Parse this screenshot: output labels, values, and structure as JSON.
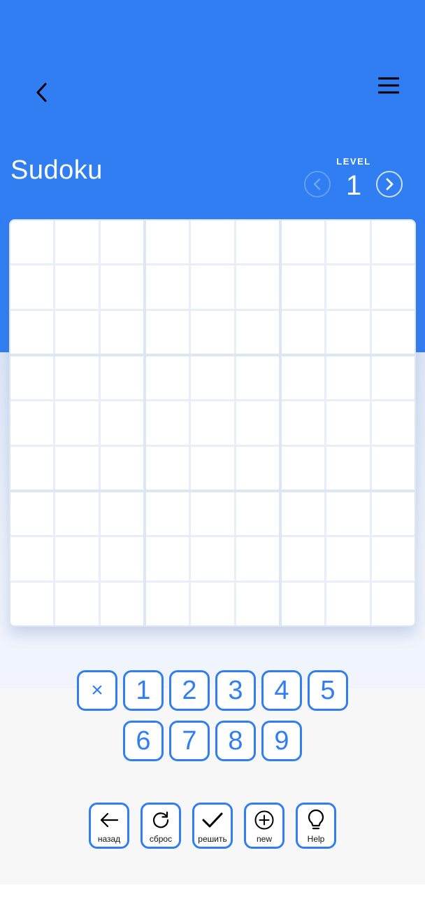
{
  "header": {
    "title": "Sudoku",
    "back_icon": "chevron-left-icon",
    "menu_icon": "hamburger-menu-icon"
  },
  "level": {
    "label": "LEVEL",
    "value": "1",
    "prev_icon": "chevron-left-icon",
    "next_icon": "chevron-right-icon"
  },
  "board": {
    "cells": [
      [
        "",
        "",
        "",
        "",
        "",
        "",
        "",
        "",
        ""
      ],
      [
        "",
        "",
        "",
        "",
        "",
        "",
        "",
        "",
        ""
      ],
      [
        "",
        "",
        "",
        "",
        "",
        "",
        "",
        "",
        ""
      ],
      [
        "",
        "",
        "",
        "",
        "",
        "",
        "",
        "",
        ""
      ],
      [
        "",
        "",
        "",
        "",
        "",
        "",
        "",
        "",
        ""
      ],
      [
        "",
        "",
        "",
        "",
        "",
        "",
        "",
        "",
        ""
      ],
      [
        "",
        "",
        "",
        "",
        "",
        "",
        "",
        "",
        ""
      ],
      [
        "",
        "",
        "",
        "",
        "",
        "",
        "",
        "",
        ""
      ],
      [
        "",
        "",
        "",
        "",
        "",
        "",
        "",
        "",
        ""
      ]
    ]
  },
  "keypad": {
    "erase": "×",
    "row1": [
      "1",
      "2",
      "3",
      "4",
      "5"
    ],
    "row2": [
      "6",
      "7",
      "8",
      "9"
    ]
  },
  "actions": {
    "undo": "назад",
    "reset": "сброс",
    "solve": "решить",
    "new": "new",
    "help": "Help"
  },
  "colors": {
    "primary": "#317ef3",
    "header_bg": "#317ef3",
    "board_line": "#dde6f3",
    "bottom_bg": "#f7f7f7"
  }
}
